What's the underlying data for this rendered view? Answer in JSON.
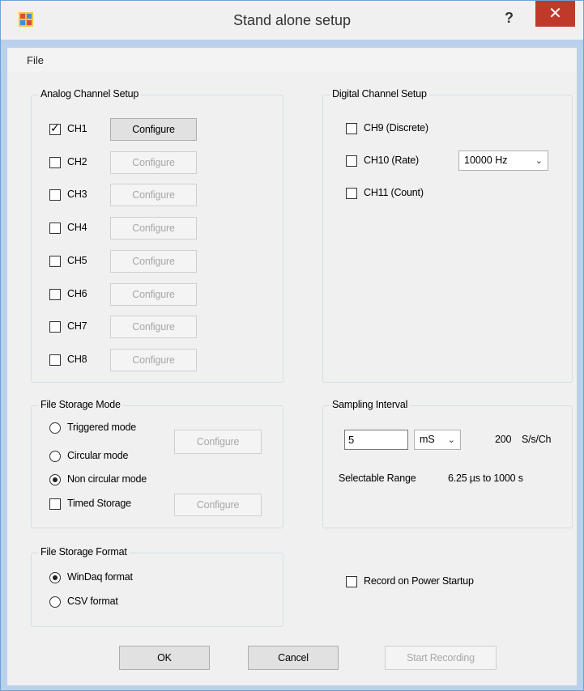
{
  "window": {
    "title": "Stand alone setup",
    "help": "?",
    "close": "✕"
  },
  "menu": {
    "file": "File"
  },
  "analog": {
    "title": "Analog Channel Setup",
    "channels": [
      {
        "label": "CH1",
        "checked": true,
        "configure": "Configure"
      },
      {
        "label": "CH2",
        "checked": false,
        "configure": "Configure"
      },
      {
        "label": "CH3",
        "checked": false,
        "configure": "Configure"
      },
      {
        "label": "CH4",
        "checked": false,
        "configure": "Configure"
      },
      {
        "label": "CH5",
        "checked": false,
        "configure": "Configure"
      },
      {
        "label": "CH6",
        "checked": false,
        "configure": "Configure"
      },
      {
        "label": "CH7",
        "checked": false,
        "configure": "Configure"
      },
      {
        "label": "CH8",
        "checked": false,
        "configure": "Configure"
      }
    ]
  },
  "digital": {
    "title": "Digital Channel Setup",
    "ch9": "CH9 (Discrete)",
    "ch10": "CH10 (Rate)",
    "ch10_rate": "10000 Hz",
    "ch11": "CH11 (Count)"
  },
  "storage_mode": {
    "title": "File Storage Mode",
    "triggered": "Triggered mode",
    "circular": "Circular mode",
    "non_circular": "Non circular mode",
    "selected": "non_circular",
    "configure": "Configure",
    "timed": "Timed Storage",
    "timed_configure": "Configure"
  },
  "sampling": {
    "title": "Sampling Interval",
    "value": "5",
    "unit": "mS",
    "rate": "200",
    "rate_unit": "S/s/Ch",
    "range_label": "Selectable Range",
    "range_value": "6.25 µs to 1000 s"
  },
  "storage_format": {
    "title": "File Storage Format",
    "windaq": "WinDaq format",
    "csv": "CSV format",
    "selected": "windaq"
  },
  "record_on_power": "Record on Power Startup",
  "buttons": {
    "ok": "OK",
    "cancel": "Cancel",
    "start": "Start Recording"
  }
}
